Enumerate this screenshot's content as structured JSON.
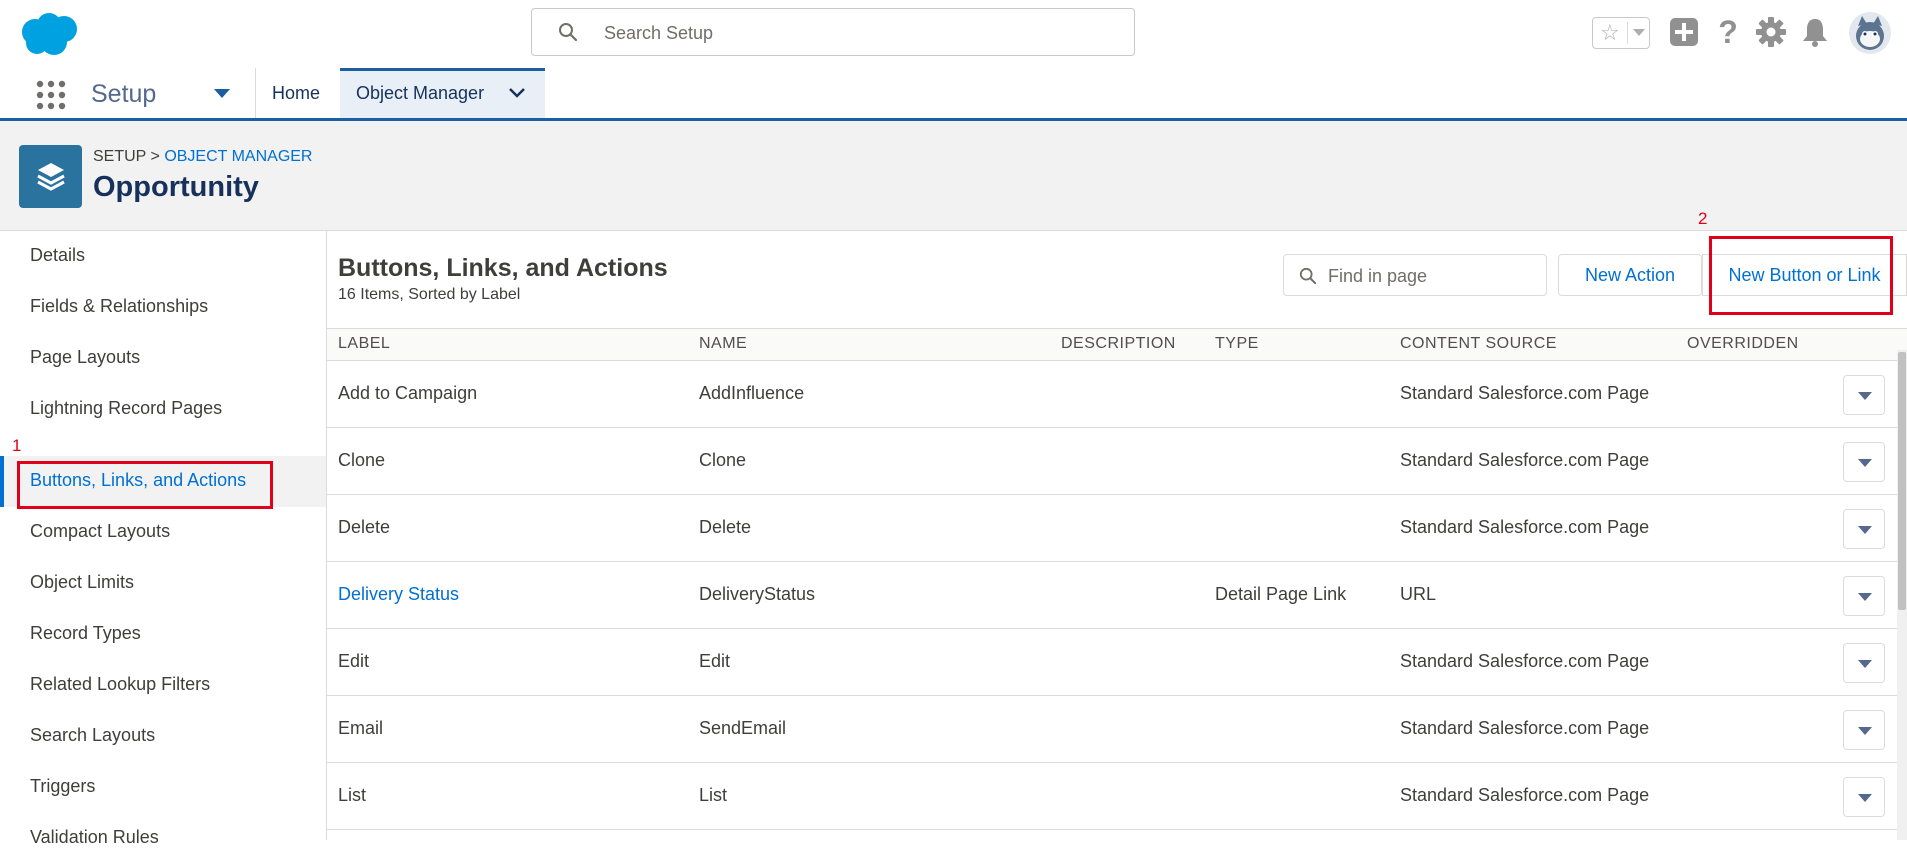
{
  "header": {
    "search_placeholder": "Search Setup",
    "icons": [
      "cloud-logo-icon",
      "star-icon",
      "add-icon",
      "help-icon",
      "gear-icon",
      "bell-icon",
      "avatar"
    ]
  },
  "nav": {
    "app_name": "Setup",
    "tabs": [
      {
        "label": "Home"
      },
      {
        "label": "Object Manager"
      }
    ]
  },
  "page_header": {
    "breadcrumb_root": "SETUP",
    "breadcrumb_sep": ">",
    "breadcrumb_link": "OBJECT MANAGER",
    "title": "Opportunity"
  },
  "sidebar": {
    "items": [
      {
        "label": "Details"
      },
      {
        "label": "Fields & Relationships"
      },
      {
        "label": "Page Layouts"
      },
      {
        "label": "Lightning Record Pages"
      },
      {
        "label": "Buttons, Links, and Actions"
      },
      {
        "label": "Compact Layouts"
      },
      {
        "label": "Object Limits"
      },
      {
        "label": "Record Types"
      },
      {
        "label": "Related Lookup Filters"
      },
      {
        "label": "Search Layouts"
      },
      {
        "label": "Triggers"
      },
      {
        "label": "Validation Rules"
      }
    ],
    "active_index": 4
  },
  "main": {
    "title": "Buttons, Links, and Actions",
    "subtitle": "16 Items, Sorted by Label",
    "find_placeholder": "Find in page",
    "new_action_label": "New Action",
    "new_button_label": "New Button or Link"
  },
  "annotations": {
    "marker_1": "1",
    "marker_2": "2"
  },
  "table": {
    "columns": [
      "LABEL",
      "NAME",
      "DESCRIPTION",
      "TYPE",
      "CONTENT SOURCE",
      "OVERRIDDEN"
    ],
    "rows": [
      {
        "label": "Add to Campaign",
        "name": "AddInfluence",
        "description": "",
        "type": "",
        "content_source": "Standard Salesforce.com Page",
        "overridden": ""
      },
      {
        "label": "Clone",
        "name": "Clone",
        "description": "",
        "type": "",
        "content_source": "Standard Salesforce.com Page",
        "overridden": ""
      },
      {
        "label": "Delete",
        "name": "Delete",
        "description": "",
        "type": "",
        "content_source": "Standard Salesforce.com Page",
        "overridden": ""
      },
      {
        "label": "Delivery Status",
        "name": "DeliveryStatus",
        "description": "",
        "type": "Detail Page Link",
        "content_source": "URL",
        "overridden": ""
      },
      {
        "label": "Edit",
        "name": "Edit",
        "description": "",
        "type": "",
        "content_source": "Standard Salesforce.com Page",
        "overridden": ""
      },
      {
        "label": "Email",
        "name": "SendEmail",
        "description": "",
        "type": "",
        "content_source": "Standard Salesforce.com Page",
        "overridden": ""
      },
      {
        "label": "List",
        "name": "List",
        "description": "",
        "type": "",
        "content_source": "Standard Salesforce.com Page",
        "overridden": ""
      }
    ]
  },
  "colors": {
    "brand": "#0070d2",
    "nav_accent": "#1b5f9e",
    "object_icon": "#2a739e",
    "annotation": "#e0001a"
  }
}
